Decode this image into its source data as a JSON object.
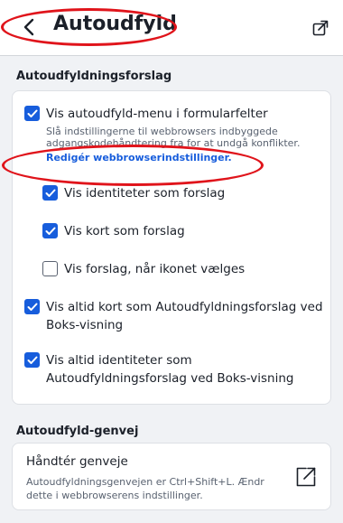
{
  "header": {
    "title": "Autoudfyld",
    "back_icon": "chevron-left-icon",
    "popout_icon": "popout-icon"
  },
  "suggestions": {
    "section_title": "Autoudfyldningsforslag",
    "main_option": {
      "label": "Vis autoudfyld-menu i formularfelter",
      "checked": true,
      "helper_line1": "Slå indstillingerne til webbrowsers indbyggede",
      "helper_line2": "adgangskodehåndtering fra for at undgå konflikter.",
      "link": "Redigér webbrowserindstillinger."
    },
    "sub_options": [
      {
        "label": "Vis identiteter som forslag",
        "checked": true
      },
      {
        "label": "Vis kort som forslag",
        "checked": true
      },
      {
        "label": "Vis forslag, når ikonet vælges",
        "checked": false
      }
    ],
    "option_cards": {
      "line1": "Vis altid kort som Autoudfyldningsforslag ved",
      "line2": "Boks-visning",
      "checked": true
    },
    "option_identities": {
      "line1": "Vis altid identiteter som",
      "line2": "Autoudfyldningsforslag ved Boks-visning",
      "checked": true
    }
  },
  "shortcut": {
    "section_title": "Autoudfyld-genvej",
    "item_title": "Håndtér genveje",
    "helper_line1": "Autoudfyldningsgenvejen er Ctrl+Shift+L. Ændr",
    "helper_line2": "dette i webbrowserens indstillinger.",
    "icon": "external-link-icon"
  },
  "colors": {
    "accent": "#175ddc",
    "annotation": "#e0141b",
    "background": "#f0f2f5"
  }
}
